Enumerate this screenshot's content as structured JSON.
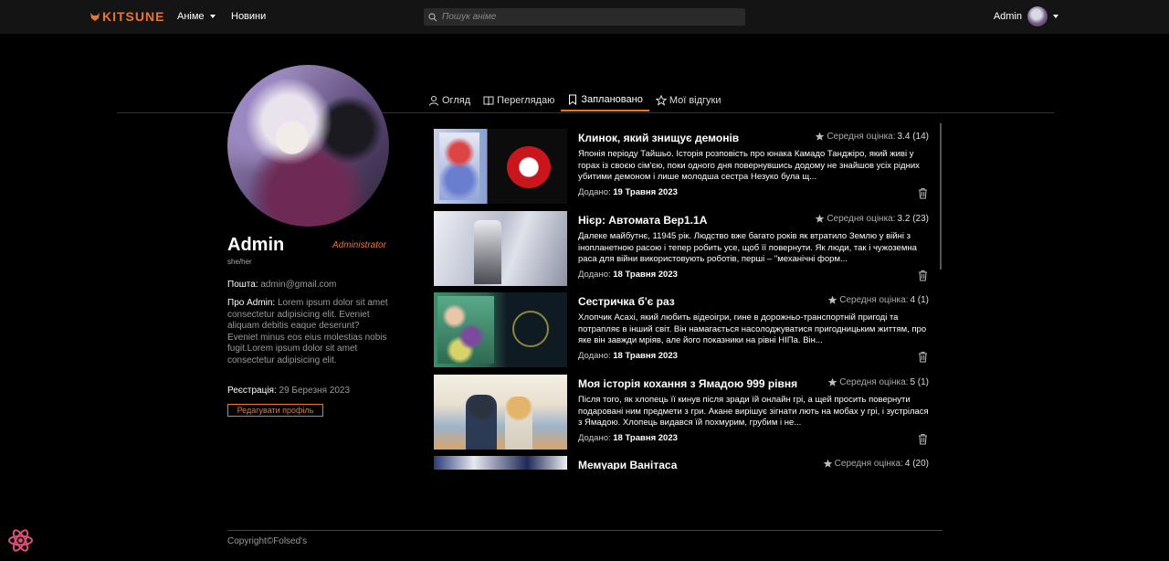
{
  "header": {
    "brand": "KITSUNE",
    "nav": {
      "anime": "Аніме",
      "news": "Новини"
    },
    "search": {
      "placeholder": "Пошук аніме"
    },
    "user": {
      "name": "Admin"
    }
  },
  "profile": {
    "name": "Admin",
    "role": "Administrator",
    "pronouns": "she/her",
    "email_label": "Пошта:",
    "email": "admin@gmail.com",
    "about_label": "Про Admin:",
    "about": "Lorem ipsum dolor sit amet consectetur adipisicing elit. Eveniet aliquam debitis eaque deserunt? Eveniet minus eos eius molestias nobis fugit.Lorem ipsum dolor sit amet consectetur adipisicing elit.",
    "registered_label": "Реєстрація:",
    "registered": "29 Березня 2023",
    "edit_button": "Редагувати профіль"
  },
  "tabs": [
    {
      "label": "Огляд",
      "icon": "user-icon",
      "active": false
    },
    {
      "label": "Переглядаю",
      "icon": "book-icon",
      "active": false
    },
    {
      "label": "Заплановано",
      "icon": "bookmark-icon",
      "active": true
    },
    {
      "label": "Мої відгуки",
      "icon": "star-icon",
      "active": false
    }
  ],
  "list": {
    "rating_label": "Середня оцінка:",
    "added_label": "Додано:",
    "items": [
      {
        "title": "Клинок, який знищує демонів",
        "rating": "3.4 (14)",
        "description": "Японія періоду Тайшьо. Історія розповість про юнака Камадо Танджіро, який живі у горах із своєю сім'єю, поки одного дня повернувшись додому не знайшов усіх рідних убитими демоном і лише молодша сестра Незуко була щ...",
        "added": "19 Травня 2023"
      },
      {
        "title": "Нієр: Автомата Вер1.1А",
        "rating": "3.2 (23)",
        "description": "Далеке майбутнє, 11945 рік. Людство вже багато років як втратило Землю у війні з інопланетною расою і тепер робить усе, щоб її повернути. Як люди, так і чужоземна раса для війни використовують роботів, перші – \"механічні форм...",
        "added": "18 Травня 2023"
      },
      {
        "title": "Сестричка б'є раз",
        "rating": "4 (1)",
        "description": "Хлопчик Асахі, який любить відеоігри, гине в дорожньо-транспортній пригоді та потрапляє в інший світ. Він намагається насолоджуватися пригодницьким життям, про яке він завжди мріяв, але його показники на рівні НІПа. Він...",
        "added": "18 Травня 2023"
      },
      {
        "title": "Моя історія кохання з Ямадою 999 рівня",
        "rating": "5 (1)",
        "description": "Після того, як хлопець її кинув після зради їй онлайн грі, а щей просить повернути подаровані ним предмети з гри. Акане вирішує зігнати лють на мобах у грі, і зустрілася з Ямадою. Хлопець видався їй похмурим, грубим і не...",
        "added": "18 Травня 2023"
      },
      {
        "title": "Мемуари Ванітаса",
        "rating": "4 (20)",
        "description": "",
        "added": ""
      }
    ]
  },
  "footer": {
    "copyright": "Copyright©Folsed's"
  },
  "colors": {
    "accent": "#e8762e",
    "background": "#000000",
    "header": "#141414"
  }
}
